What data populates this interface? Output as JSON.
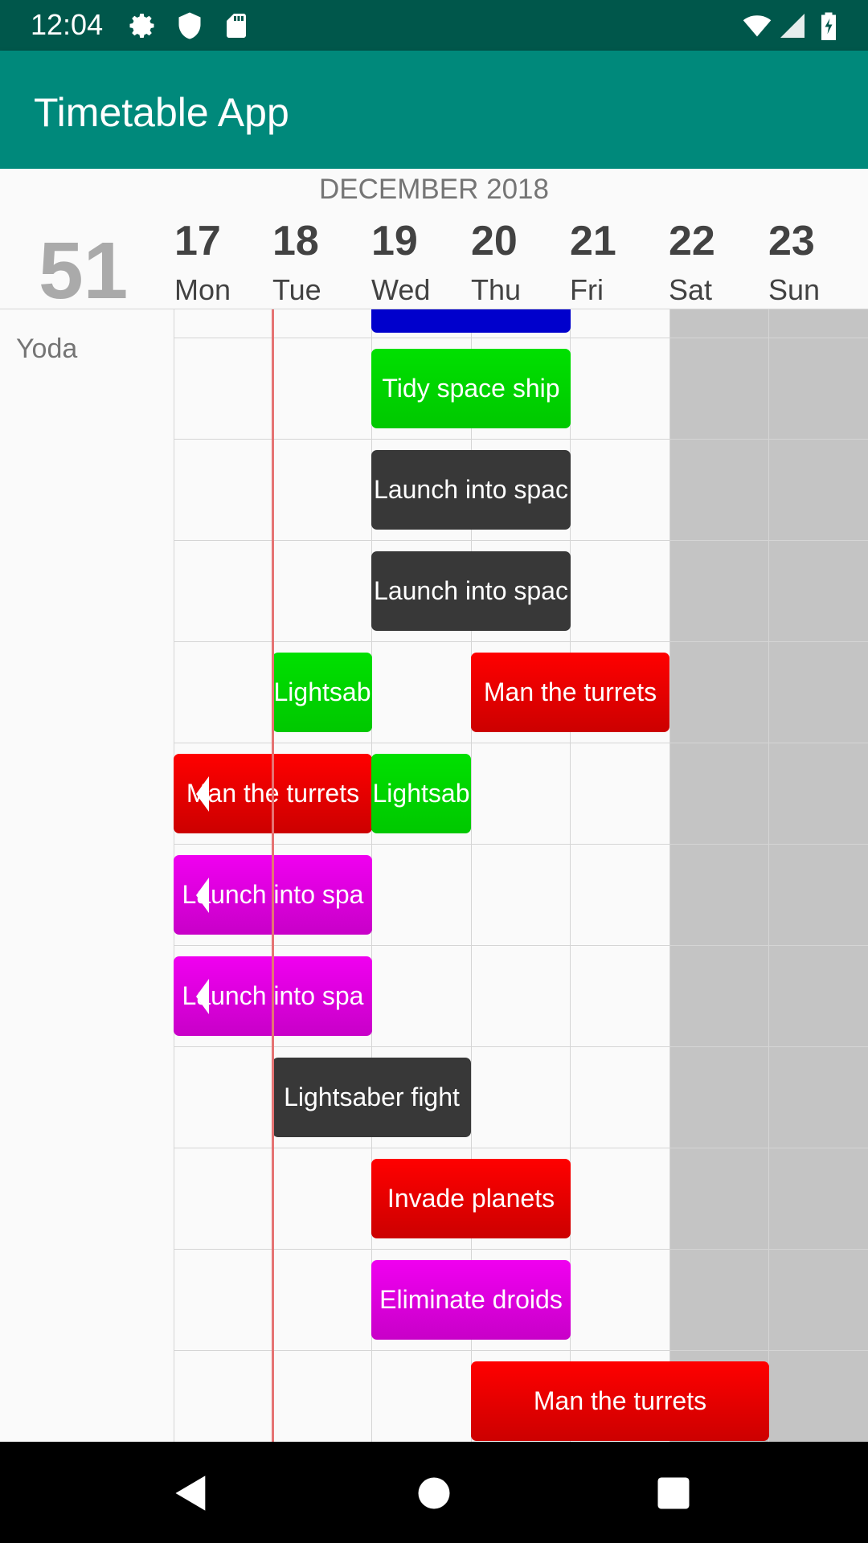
{
  "status_bar": {
    "time": "12:04",
    "icons": [
      "settings-icon",
      "shield-icon",
      "sd-card-icon",
      "wifi-icon",
      "signal-icon",
      "battery-icon"
    ]
  },
  "app_bar": {
    "title": "Timetable App"
  },
  "header": {
    "month": "DECEMBER 2018",
    "week_number": "51",
    "days": [
      {
        "num": "17",
        "name": "Mon"
      },
      {
        "num": "18",
        "name": "Tue"
      },
      {
        "num": "19",
        "name": "Wed"
      },
      {
        "num": "20",
        "name": "Thu"
      },
      {
        "num": "21",
        "name": "Fri"
      },
      {
        "num": "22",
        "name": "Sat"
      },
      {
        "num": "23",
        "name": "Sun"
      }
    ]
  },
  "rows": [
    {
      "label": "Yoda"
    }
  ],
  "events": [
    {
      "label": "",
      "color": "blue"
    },
    {
      "label": "Tidy space ship",
      "color": "green"
    },
    {
      "label": "Launch into spac",
      "color": "dark"
    },
    {
      "label": "Launch into spac",
      "color": "dark"
    },
    {
      "label": "Lightsab",
      "color": "green"
    },
    {
      "label": "Man the turrets",
      "color": "red"
    },
    {
      "label": "Man the turrets",
      "color": "red",
      "continues_from_previous_week": true
    },
    {
      "label": "Lightsab",
      "color": "green"
    },
    {
      "label": "Launch into spa",
      "color": "magenta",
      "continues_from_previous_week": true
    },
    {
      "label": "Launch into spa",
      "color": "magenta",
      "continues_from_previous_week": true
    },
    {
      "label": "Lightsaber fight",
      "color": "dark"
    },
    {
      "label": "Invade planets",
      "color": "red"
    },
    {
      "label": "Eliminate droids",
      "color": "magenta"
    },
    {
      "label": "Man the turrets",
      "color": "red"
    }
  ],
  "colors": {
    "status_bar": "#00574b",
    "app_bar": "#00897b",
    "weekend": "#c4c4c4",
    "now_line": "#e57373",
    "green": "#00d000",
    "dark": "#383838",
    "red": "#e00000",
    "magenta": "#e000e0",
    "blue": "#0000cc"
  },
  "nav_bar": {
    "buttons": [
      "back-icon",
      "home-icon",
      "recents-icon"
    ]
  }
}
